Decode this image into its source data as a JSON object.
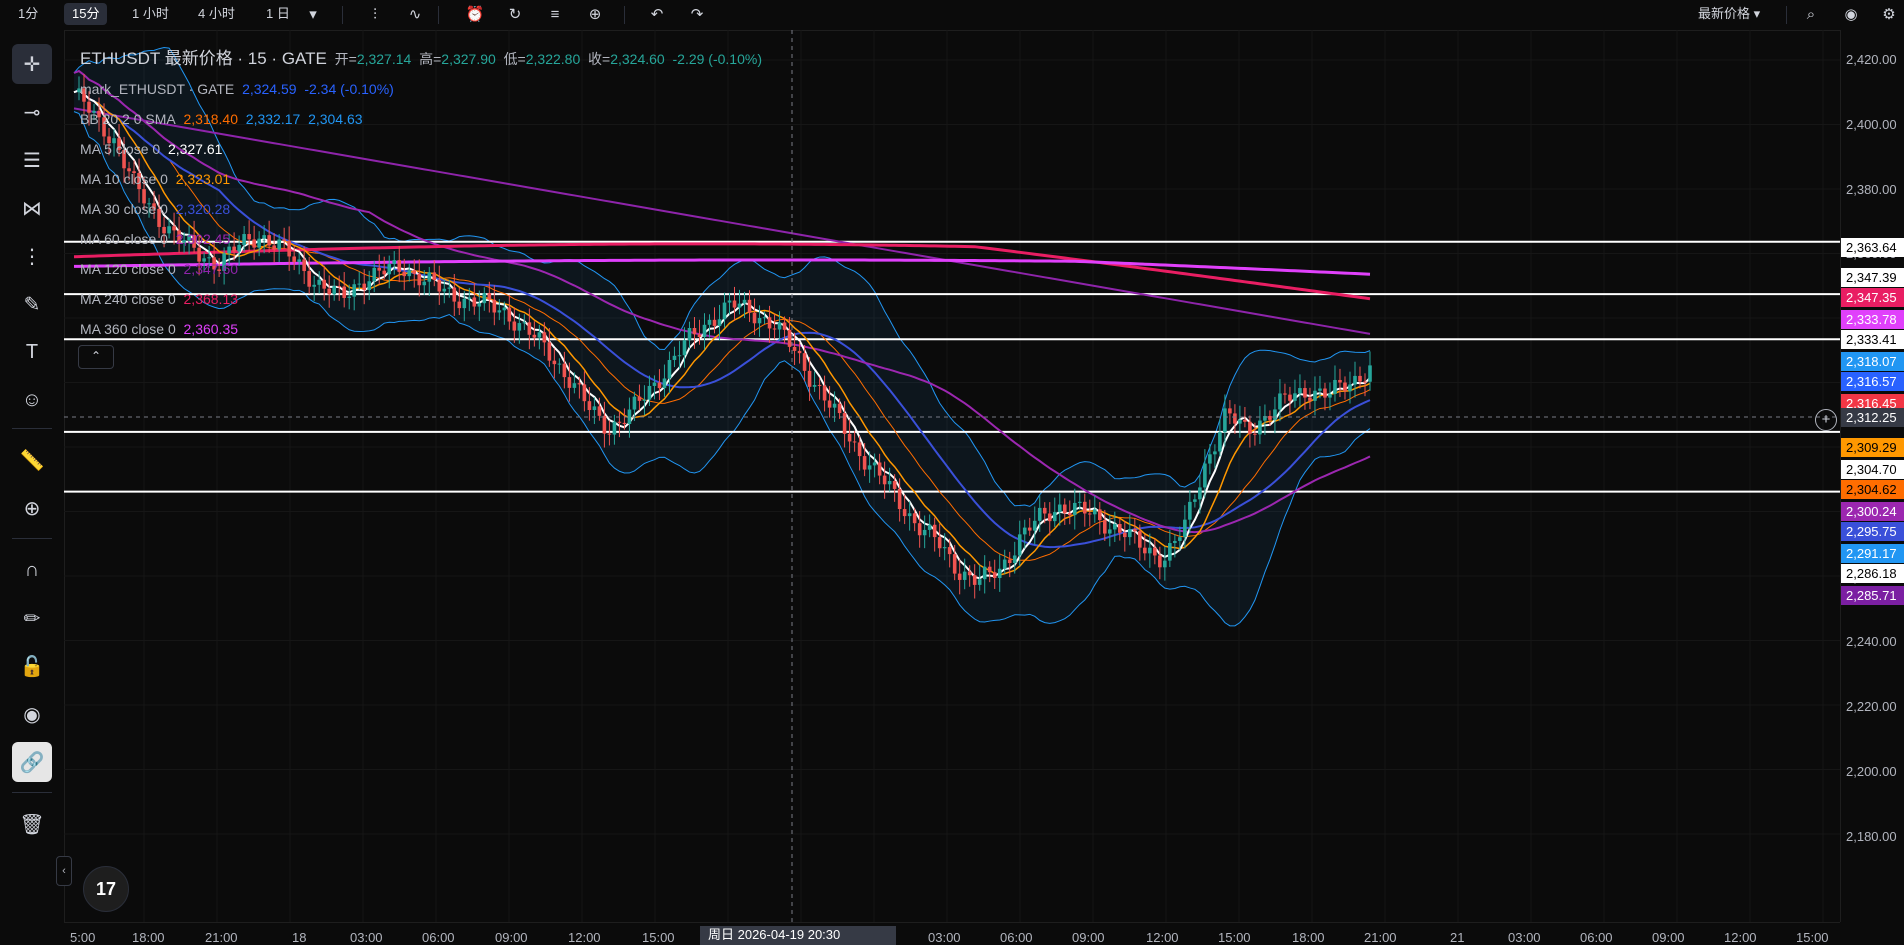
{
  "topbar": {
    "intervals": [
      "1分",
      "15分",
      "1 小时",
      "4 小时",
      "1 日"
    ],
    "active_interval": "15分",
    "price_type": "最新价格 ▾"
  },
  "legend": {
    "symbol_title": "ETHUSDT 最新价格 · 15 · GATE",
    "open_label": "开=",
    "open": "2,327.14",
    "high_label": "高=",
    "high": "2,327.90",
    "low_label": "低=",
    "low": "2,322.80",
    "close_label": "收=",
    "close": "2,324.60",
    "change": "-2.29 (-0.10%)",
    "indicators": [
      {
        "name": "mark_ETHUSDT · GATE",
        "values": [
          "2,324.59",
          "-2.34 (-0.10%)"
        ],
        "colors": [
          "#2962ff",
          "#2962ff"
        ]
      },
      {
        "name": "BB 20 2 0 SMA",
        "values": [
          "2,318.40",
          "2,332.17",
          "2,304.63"
        ],
        "colors": [
          "#ff6d00",
          "#2196f3",
          "#2196f3"
        ]
      },
      {
        "name": "MA 5 close 0",
        "values": [
          "2,327.61"
        ],
        "colors": [
          "#ffffff"
        ]
      },
      {
        "name": "MA 10 close 0",
        "values": [
          "2,323.01"
        ],
        "colors": [
          "#ff9800"
        ]
      },
      {
        "name": "MA 30 close 0",
        "values": [
          "2,320.28"
        ],
        "colors": [
          "#3a50d9"
        ]
      },
      {
        "name": "MA 60 close 0",
        "values": [
          "2,302.45"
        ],
        "colors": [
          "#9c27b0"
        ]
      },
      {
        "name": "MA 120 close 0",
        "values": [
          "2,347.60"
        ],
        "colors": [
          "#8e24aa"
        ]
      },
      {
        "name": "MA 240 close 0",
        "values": [
          "2,368.13"
        ],
        "colors": [
          "#e91e63"
        ]
      },
      {
        "name": "MA 360 close 0",
        "values": [
          "2,360.35"
        ],
        "colors": [
          "#e040fb"
        ]
      }
    ]
  },
  "price_axis": {
    "labels": [
      "2,420.00",
      "2,400.00",
      "2,380.00",
      "2,360.00",
      "2,340.00",
      "2,320.00",
      "2,300.00",
      "2,280.00",
      "2,260.00",
      "2,240.00",
      "2,220.00",
      "2,200.00",
      "2,180.00"
    ],
    "tags": [
      {
        "text": "2,363.64",
        "bg": "#ffffff",
        "fg": "#000000"
      },
      {
        "text": "2,347.39",
        "bg": "#ffffff",
        "fg": "#000000"
      },
      {
        "text": "2,347.35",
        "bg": "#e91e63",
        "fg": "#ffffff"
      },
      {
        "text": "2,333.78",
        "bg": "#e040fb",
        "fg": "#ffffff"
      },
      {
        "text": "2,333.41",
        "bg": "#ffffff",
        "fg": "#000000"
      },
      {
        "text": "2,318.07",
        "bg": "#2196f3",
        "fg": "#ffffff"
      },
      {
        "text": "2,316.57",
        "bg": "#2962ff",
        "fg": "#ffffff"
      },
      {
        "text": "2,316.45",
        "bg": "#f23645",
        "fg": "#ffffff"
      },
      {
        "text": "2,312.25",
        "bg": "#363a45",
        "fg": "#ffffff"
      },
      {
        "text": "2,309.29",
        "bg": "#ff9800",
        "fg": "#000000"
      },
      {
        "text": "2,304.70",
        "bg": "#ffffff",
        "fg": "#000000"
      },
      {
        "text": "2,304.62",
        "bg": "#ff6d00",
        "fg": "#000000"
      },
      {
        "text": "2,300.24",
        "bg": "#9c27b0",
        "fg": "#ffffff"
      },
      {
        "text": "2,295.75",
        "bg": "#3a50d9",
        "fg": "#ffffff"
      },
      {
        "text": "2,291.17",
        "bg": "#2196f3",
        "fg": "#ffffff"
      },
      {
        "text": "2,286.18",
        "bg": "#ffffff",
        "fg": "#000000"
      },
      {
        "text": "2,285.71",
        "bg": "#7b1fa2",
        "fg": "#ffffff"
      }
    ]
  },
  "time_axis": {
    "labels": [
      "5:00",
      "18:00",
      "21:00",
      "18",
      "03:00",
      "06:00",
      "09:00",
      "12:00",
      "15:00",
      "03:00",
      "06:00",
      "09:00",
      "12:00",
      "15:00",
      "18:00",
      "21:00",
      "21",
      "03:00",
      "06:00",
      "09:00",
      "12:00",
      "15:00"
    ],
    "crosshair_label": "周日 2026-04-19   20:30"
  },
  "colors": {
    "up": "#26a69a",
    "down": "#ef5350",
    "ma5": "#ffffff",
    "ma10": "#ff9800",
    "ma30": "#3a50d9",
    "ma60": "#9c27b0",
    "ma120": "#8e24aa",
    "ma240": "#e91e63",
    "ma360": "#e040fb",
    "bb": "#2196f3"
  },
  "chart_data": {
    "type": "candlestick",
    "symbol": "ETHUSDT",
    "interval": "15",
    "exchange": "GATE",
    "ylim": [
      2170,
      2430
    ],
    "close_series": [
      2410,
      2402,
      2395,
      2380,
      2372,
      2365,
      2360,
      2357,
      2362,
      2366,
      2362,
      2356,
      2350,
      2346,
      2352,
      2354,
      2356,
      2352,
      2348,
      2346,
      2344,
      2342,
      2336,
      2330,
      2322,
      2312,
      2306,
      2310,
      2318,
      2326,
      2334,
      2340,
      2344,
      2342,
      2338,
      2330,
      2320,
      2310,
      2300,
      2292,
      2284,
      2276,
      2270,
      2262,
      2258,
      2262,
      2272,
      2278,
      2282,
      2280,
      2277,
      2274,
      2268,
      2266,
      2275,
      2295,
      2310,
      2305,
      2310,
      2315,
      2318,
      2316,
      2320,
      2324.6
    ],
    "horizontal_lines": [
      2363.64,
      2347.39,
      2333.41,
      2304.7,
      2286.18
    ],
    "last_price": 2312.25
  }
}
